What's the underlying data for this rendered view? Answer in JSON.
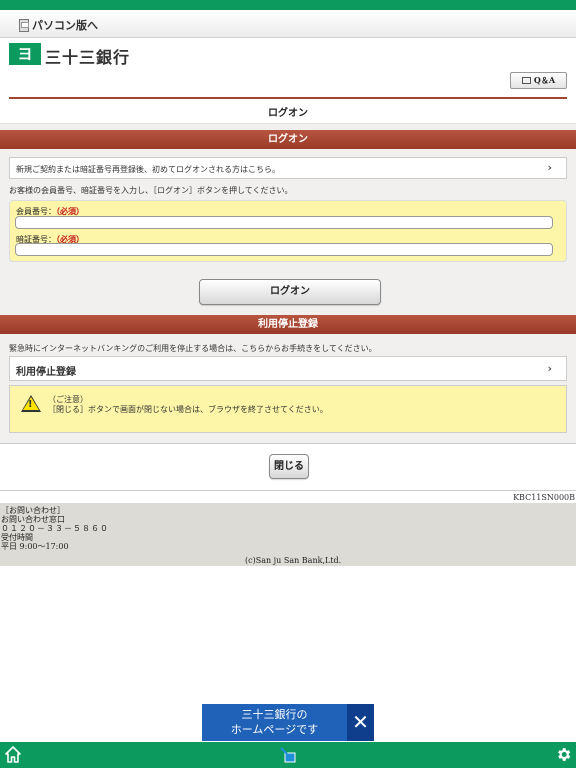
{
  "header": {
    "pc_link": "パソコン版へ",
    "bank_name": "三十三銀行",
    "qa_button": "Q＆A",
    "page_title": "ログオン"
  },
  "logon_section": {
    "header": "ログオン",
    "new_contract_link": "新規ご契約または暗証番号再登録後、初めてログオンされる方はこちら。",
    "instruction": "お客様の会員番号、暗証番号を入力し、［ログオン］ボタンを押してください。",
    "member_number_label": "会員番号：",
    "member_number_required": "（必須）",
    "member_number_value": "",
    "pin_label": "暗証番号：",
    "pin_required": "（必須）",
    "pin_value": "",
    "logon_button": "ログオン"
  },
  "suspension_section": {
    "header": "利用停止登録",
    "description": "緊急時にインターネットバンキングのご利用を停止する場合は、こちらからお手続きをしてください。",
    "link_label": "利用停止登録"
  },
  "caution": {
    "title": "（ご注意）",
    "text": "［閉じる］ボタンで画面が閉じない場合は、ブラウザを終了させてください。"
  },
  "close_button": "閉じる",
  "screen_id": "KBC11SN000B",
  "footer": {
    "contact_heading": "［お問い合わせ］",
    "contact_desk": "お問い合わせ窓口",
    "phone": "０１２０－３３－５８６０",
    "hours_label": "受付時間",
    "hours": "平日 9:00～17:00",
    "copyright": "(c)San ju San Bank,Ltd."
  },
  "banner": {
    "line1": "三十三銀行の",
    "line2": "ホームページです"
  },
  "icons": {
    "home": "home-icon",
    "middle": "link-icon",
    "settings": "gear-icon"
  },
  "colors": {
    "brand_green": "#0d9a5e",
    "section_red": "#a8432f",
    "form_yellow": "#fdf6a8",
    "banner_blue": "#1f62b8"
  }
}
